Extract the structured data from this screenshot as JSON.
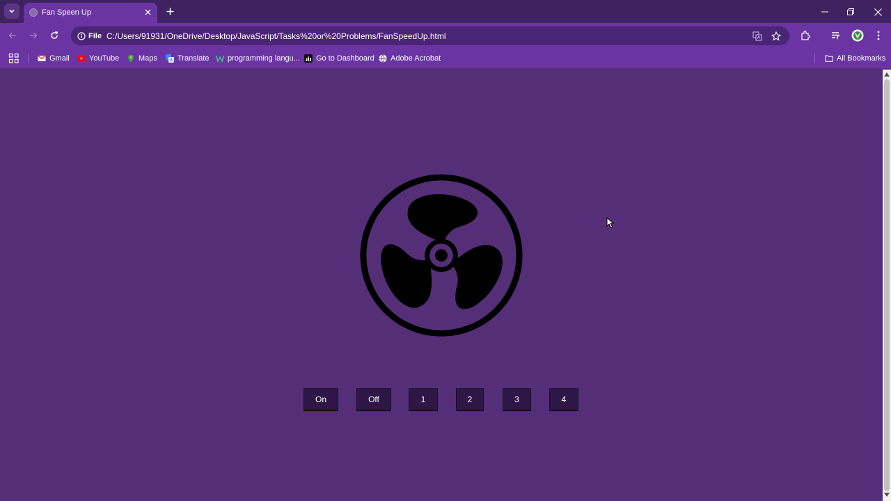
{
  "browser": {
    "tab_title": "Fan Speen Up",
    "site_info_label": "File",
    "url": "C:/Users/91931/OneDrive/Desktop/JavaScript/Tasks%20or%20Problems/FanSpeedUp.html",
    "theme_color": "#6a34a3"
  },
  "bookmarks": {
    "items": [
      {
        "label": "Gmail",
        "icon": "gmail-icon"
      },
      {
        "label": "YouTube",
        "icon": "youtube-icon"
      },
      {
        "label": "Maps",
        "icon": "maps-icon"
      },
      {
        "label": "Translate",
        "icon": "translate-icon"
      },
      {
        "label": "programming langu...",
        "icon": "bookmark-favicon"
      },
      {
        "label": "Go to Dashboard",
        "icon": "dashboard-icon"
      },
      {
        "label": "Adobe Acrobat",
        "icon": "globe-icon"
      }
    ],
    "all_bookmarks": "All Bookmarks"
  },
  "page": {
    "background": "#552e78",
    "fan_icon": "fan-icon",
    "buttons": [
      "On",
      "Off",
      "1",
      "2",
      "3",
      "4"
    ]
  }
}
